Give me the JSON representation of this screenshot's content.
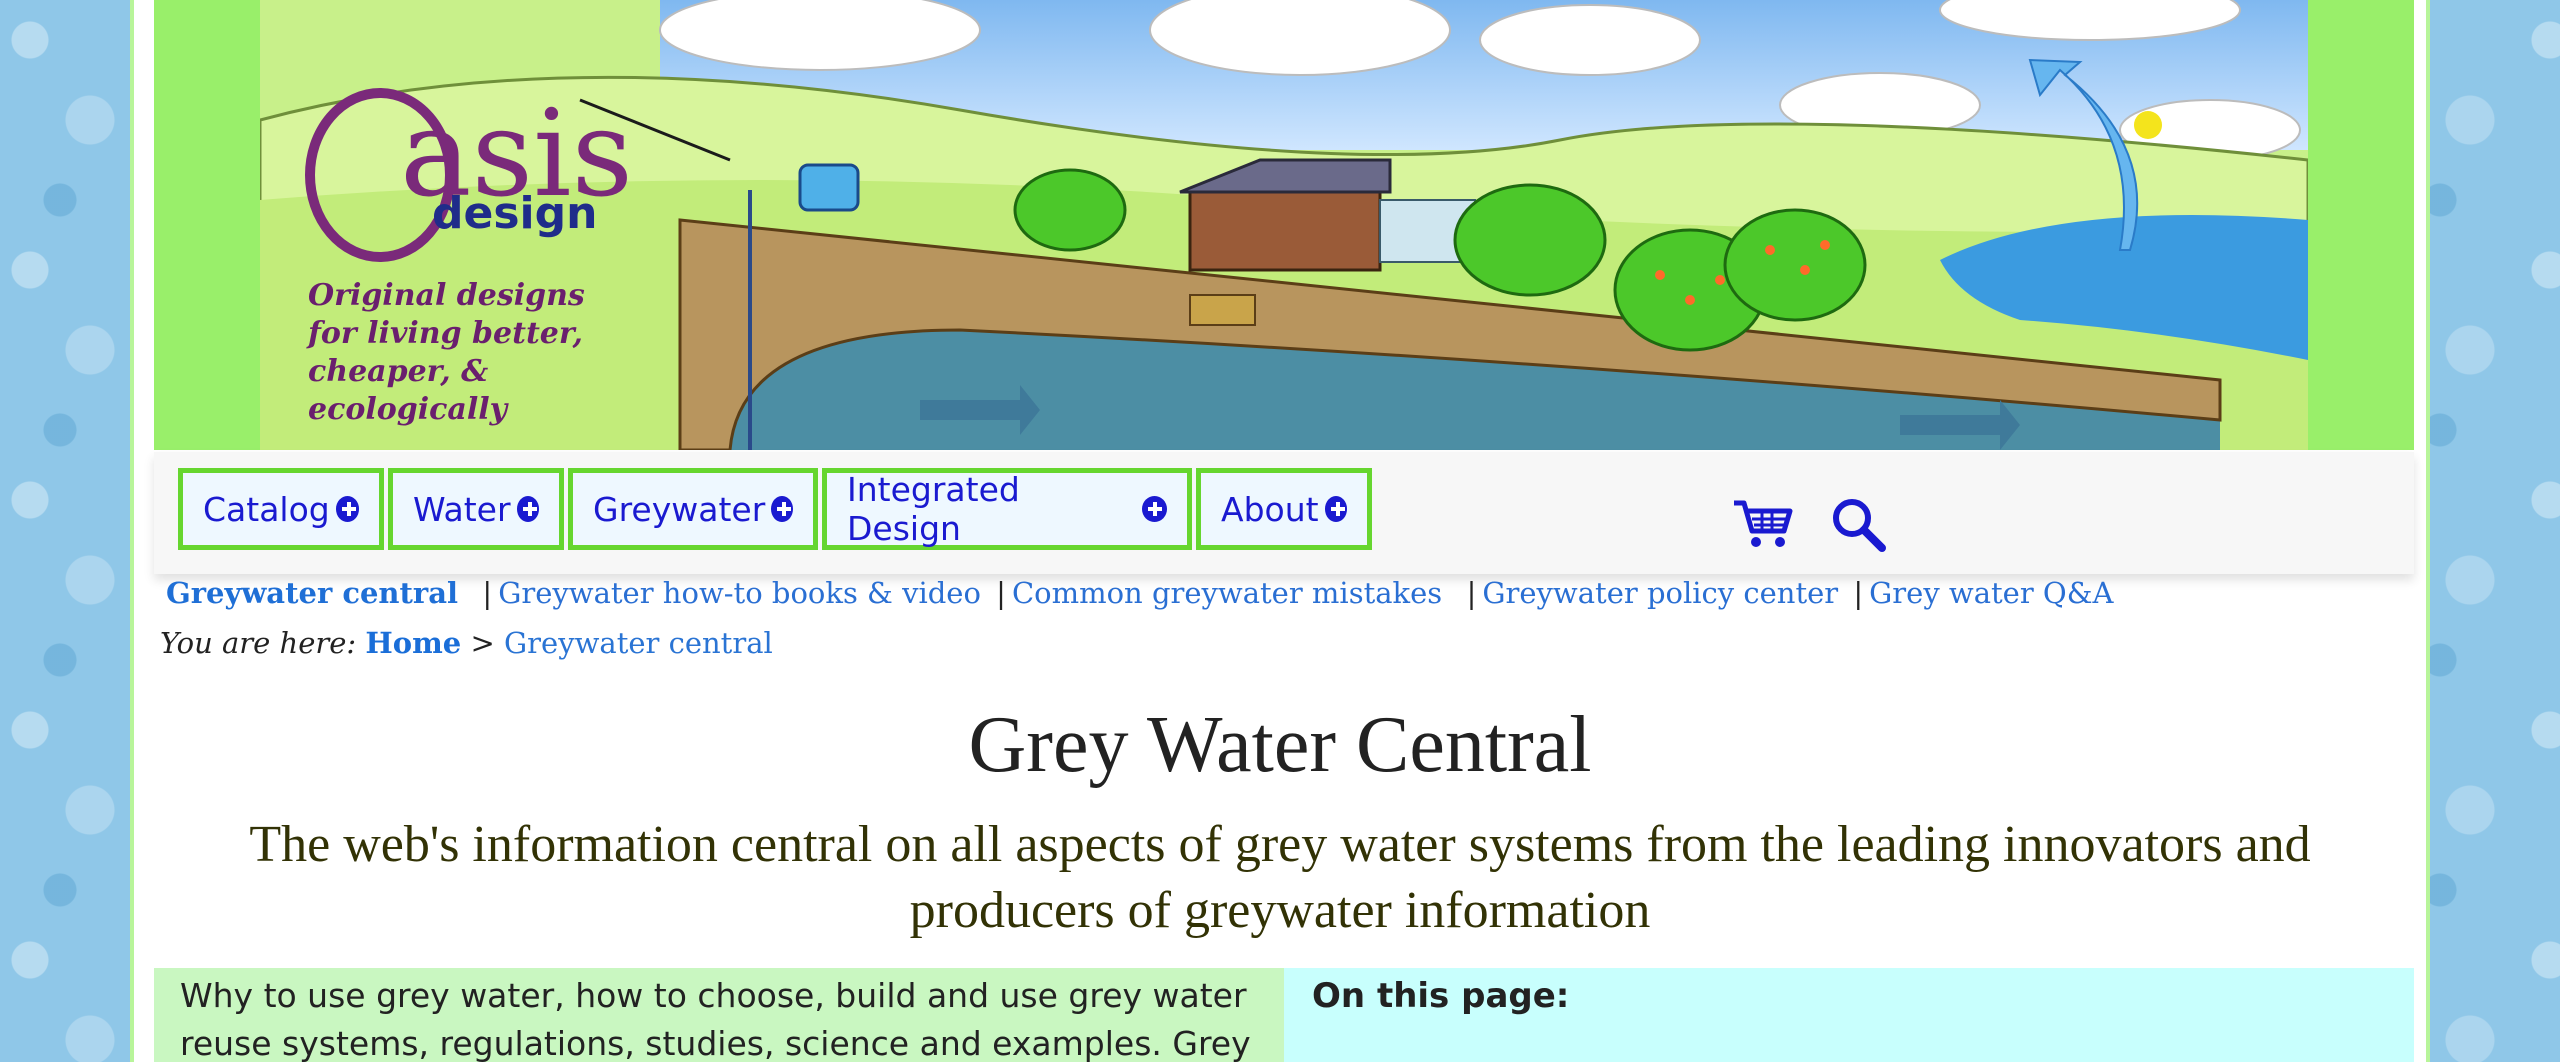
{
  "banner": {
    "logo_text": "asis",
    "logo_design": "design",
    "tagline": [
      "Original designs",
      "for living better,",
      "cheaper, &",
      "ecologically"
    ]
  },
  "nav": {
    "items": [
      {
        "label": "Catalog"
      },
      {
        "label": "Water"
      },
      {
        "label": "Greywater"
      },
      {
        "label": "Integrated Design"
      },
      {
        "label": "About"
      }
    ]
  },
  "subnav": {
    "items": [
      "Greywater central",
      "Greywater how-to books & video",
      "Common greywater mistakes",
      "Greywater policy center",
      "Grey water Q&A"
    ]
  },
  "breadcrumb": {
    "lead": "You are here:",
    "home": "Home",
    "separator": ">",
    "current": "Greywater central"
  },
  "main": {
    "title": "Grey Water Central",
    "subtitle": "The web's information central on all aspects of grey water systems from the leading innovators and producers of greywater information",
    "intro": "Why to use grey water, how to choose, build and use grey water reuse systems, regulations, studies, science and examples. Grey",
    "toc_heading": "On this page:"
  },
  "colors": {
    "nav_border": "#66d62f",
    "link": "#1a1ad0",
    "banner_bg": "#99ef6a"
  }
}
